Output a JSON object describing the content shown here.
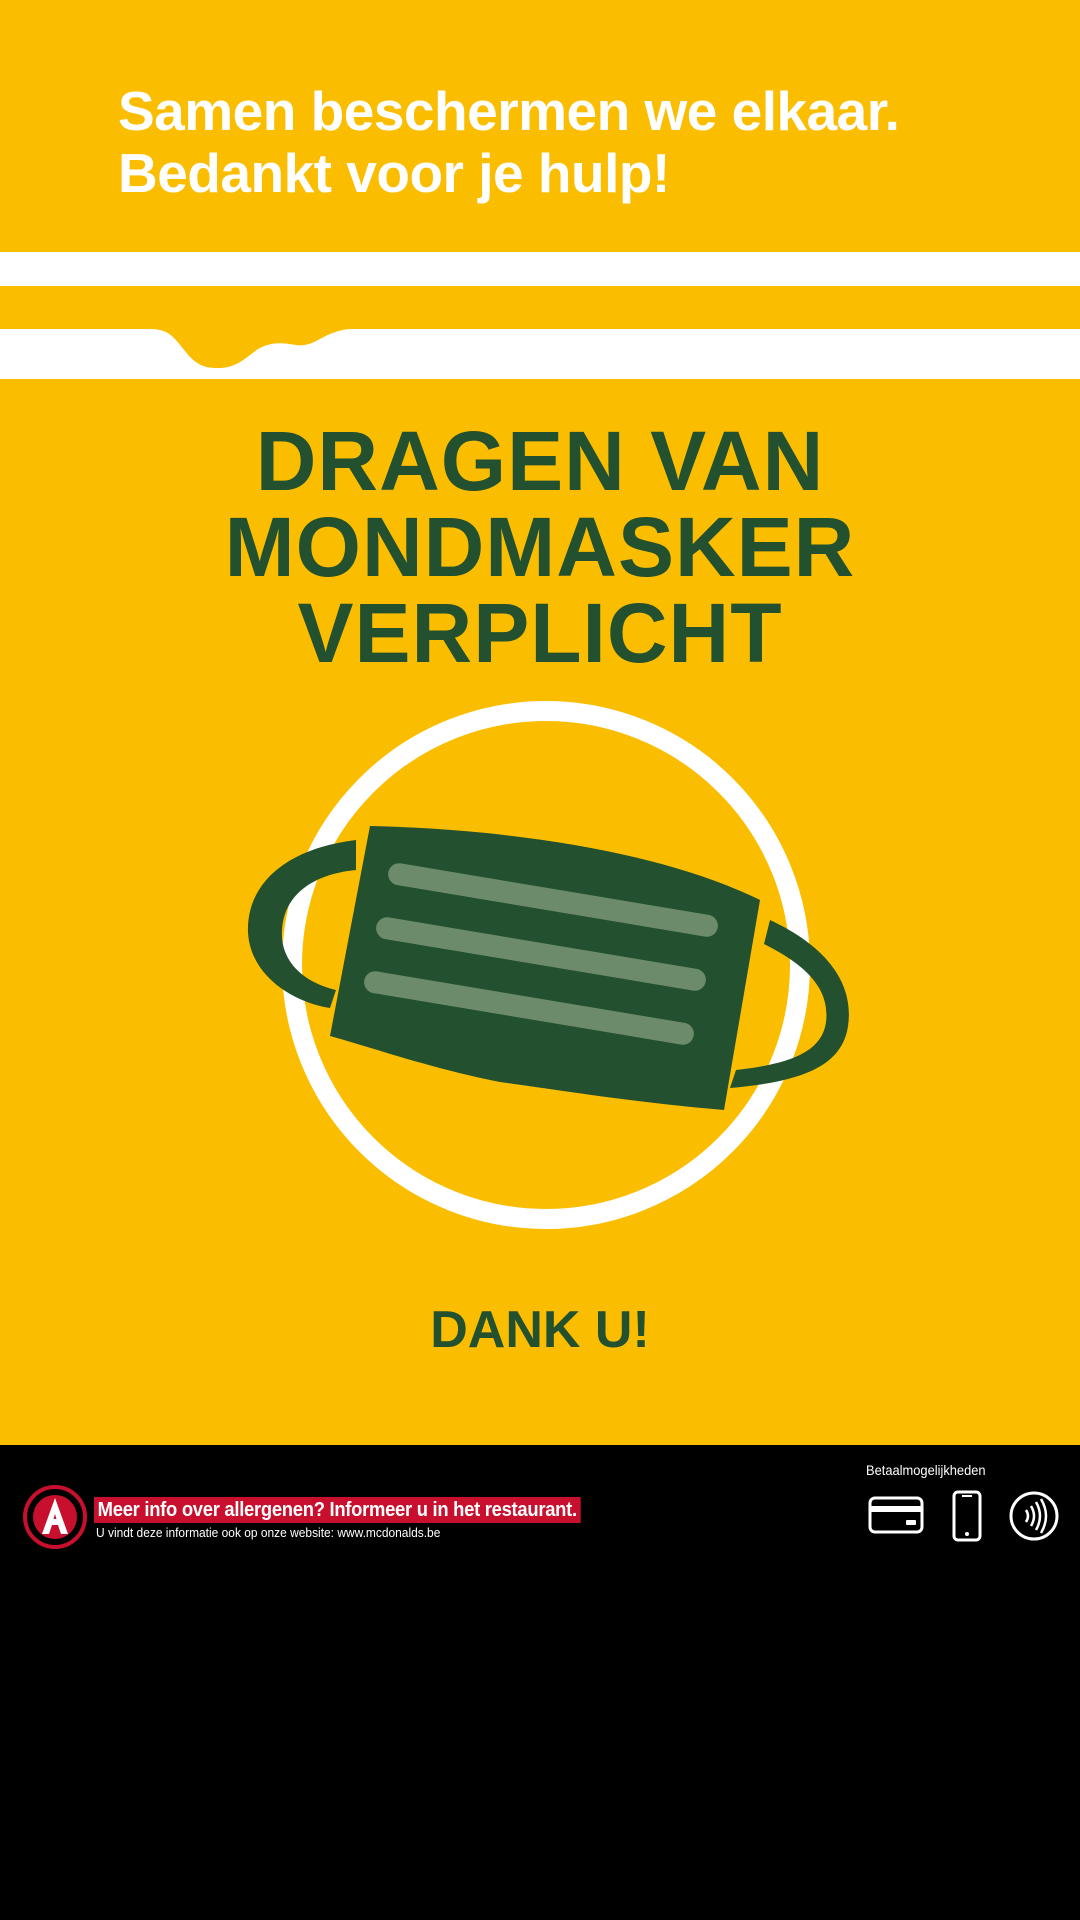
{
  "header": {
    "line1": "Samen beschermen we elkaar.",
    "line2": "Bedankt voor je hulp!"
  },
  "notice": {
    "line1": "DRAGEN VAN",
    "line2": "MONDMASKER",
    "line3": "VERPLICHT",
    "thanks": "DANK U!"
  },
  "illustration": {
    "icon": "face-mask-icon"
  },
  "footer": {
    "allergen_title": "Meer info over allergenen? Informeer u in het restaurant.",
    "allergen_subtitle": "U vindt deze informatie ook op onze website: www.mcdonalds.be",
    "allergen_icon": "allergen-a-icon",
    "payment_label": "Betaalmogelijkheden",
    "payment_icons": [
      "credit-card-icon",
      "smartphone-icon",
      "contactless-icon"
    ]
  },
  "colors": {
    "brand_yellow": "#FBBD00",
    "mask_green": "#23502F",
    "mask_pleat": "#6B8B6A",
    "allergen_red": "#C8102E",
    "footer_black": "#000000",
    "white": "#FFFFFF"
  }
}
